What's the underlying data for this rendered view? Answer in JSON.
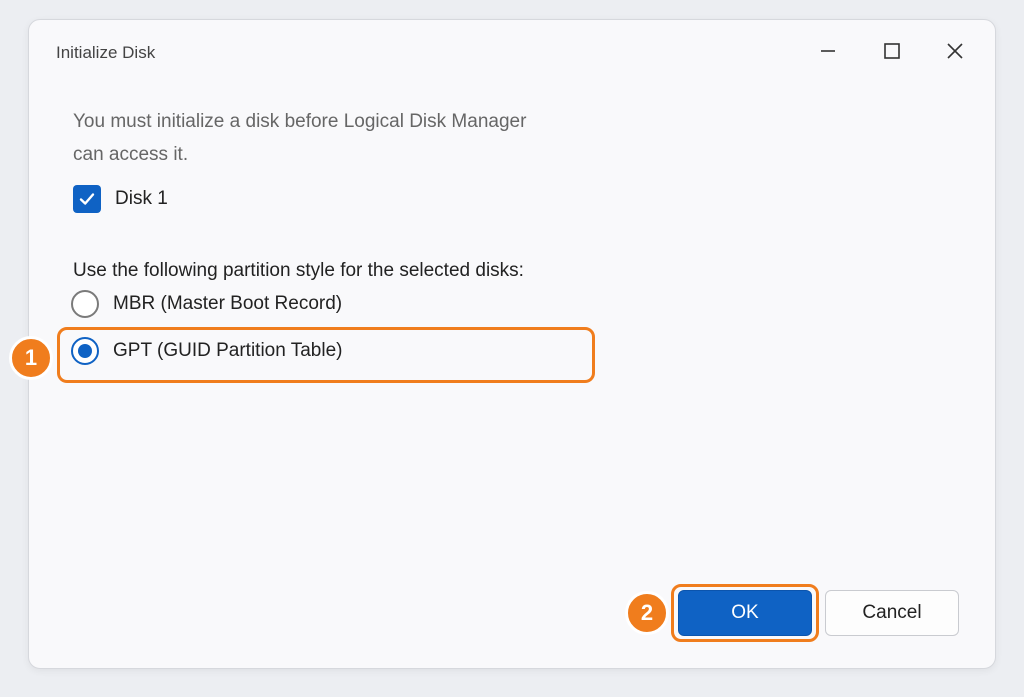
{
  "window": {
    "title": "Initialize Disk",
    "controls": {
      "minimize_icon": "minimize-icon",
      "maximize_icon": "maximize-icon",
      "close_icon": "close-icon"
    }
  },
  "description": {
    "line1": "You must initialize a disk before Logical Disk Manager",
    "line2": "can access it."
  },
  "disks": [
    {
      "label": "Disk 1",
      "checked": true
    }
  ],
  "partition": {
    "prompt": "Use the following partition style for the selected disks:",
    "options": [
      {
        "label": "MBR (Master Boot Record)",
        "selected": false
      },
      {
        "label": "GPT (GUID Partition Table)",
        "selected": true
      }
    ]
  },
  "annotations": {
    "step1": "1",
    "step2": "2",
    "highlight_color": "#f07d1d"
  },
  "buttons": {
    "ok": "OK",
    "cancel": "Cancel"
  },
  "colors": {
    "accent": "#0f62c4",
    "background": "#eceef2",
    "dialog": "#f9f9fb"
  }
}
